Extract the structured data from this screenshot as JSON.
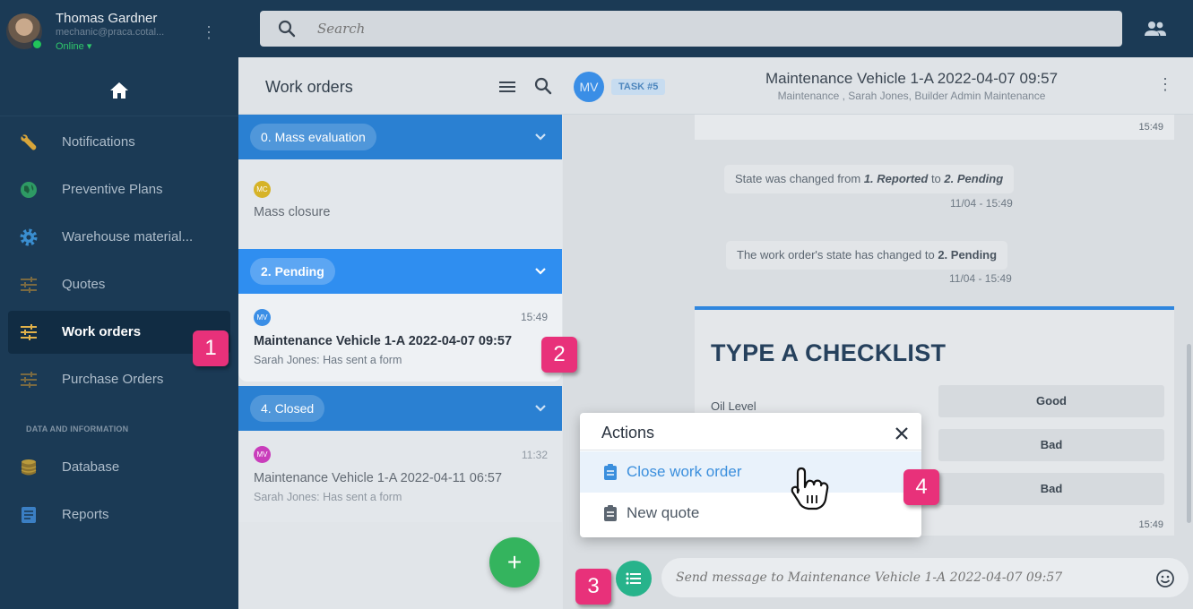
{
  "user": {
    "name": "Thomas Gardner",
    "email": "mechanic@praca.cotal...",
    "status": "Online"
  },
  "search": {
    "placeholder": "Search"
  },
  "sidebar": {
    "items": [
      {
        "label": "Notifications",
        "icon": "wrench-icon"
      },
      {
        "label": "Preventive Plans",
        "icon": "globe-icon"
      },
      {
        "label": "Warehouse material...",
        "icon": "gear-icon"
      },
      {
        "label": "Quotes",
        "icon": "sliders-icon"
      },
      {
        "label": "Work orders",
        "icon": "sliders-icon",
        "active": true
      },
      {
        "label": "Purchase Orders",
        "icon": "sliders-icon"
      }
    ],
    "section_label": "DATA AND INFORMATION",
    "data_items": [
      {
        "label": "Database",
        "icon": "database-icon"
      },
      {
        "label": "Reports",
        "icon": "document-icon"
      }
    ]
  },
  "work_orders": {
    "title": "Work orders",
    "groups": [
      {
        "label": "0. Mass evaluation",
        "items": [
          {
            "avatar": "MC",
            "avatar_color": "#d6b327",
            "title": "Mass closure"
          }
        ]
      },
      {
        "label": "2. Pending",
        "items": [
          {
            "avatar": "MV",
            "avatar_color": "#3a8ee6",
            "time": "15:49",
            "title": "Maintenance Vehicle 1-A 2022-04-07 09:57",
            "subtitle": "Sarah Jones: Has sent a form"
          }
        ]
      },
      {
        "label": "4. Closed",
        "items": [
          {
            "avatar": "MV",
            "avatar_color": "#c93dbb",
            "time": "11:32",
            "title": "Maintenance Vehicle 1-A 2022-04-11 06:57",
            "subtitle": "Sarah Jones: Has sent a form"
          }
        ]
      }
    ],
    "fab_label": "+"
  },
  "chat": {
    "avatar": "MV",
    "task_badge": "TASK #5",
    "title": "Maintenance Vehicle 1-A 2022-04-07 09:57",
    "subtitle": "Maintenance , Sarah Jones, Builder Admin Maintenance",
    "top_time": "15:49",
    "messages": [
      {
        "prefix": "State was changed from ",
        "from": "1. Reported",
        "mid": " to ",
        "to": "2. Pending",
        "time": "11/04 - 15:49"
      },
      {
        "prefix": "The work order's state has changed to ",
        "to": "2. Pending",
        "time": "11/04 - 15:49"
      }
    ],
    "checklist": {
      "title": "TYPE A CHECKLIST",
      "rows": [
        {
          "label": "Oil Level",
          "value": "Good"
        },
        {
          "label": "",
          "value": "Bad"
        },
        {
          "label": "",
          "value": "Bad"
        }
      ],
      "time": "15:49"
    },
    "input_placeholder": "Send message to Maintenance Vehicle 1-A 2022-04-07 09:57"
  },
  "actions_popup": {
    "title": "Actions",
    "items": [
      {
        "label": "Close work order",
        "hover": true
      },
      {
        "label": "New quote"
      }
    ]
  },
  "steps": [
    "1",
    "2",
    "3",
    "4"
  ],
  "colors": {
    "sidebar": "#1b3a55",
    "accent_blue": "#2f8ef0",
    "step_badge": "#e8317a",
    "fab": "#34b45e",
    "compose_button": "#27b38b"
  }
}
